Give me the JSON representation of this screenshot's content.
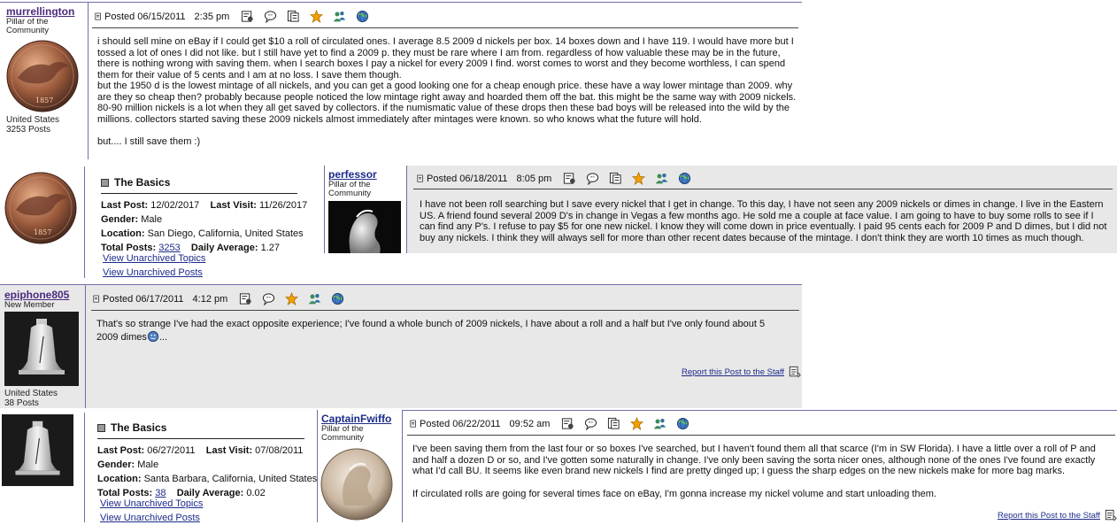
{
  "posts": [
    {
      "username": "murrellington",
      "rank": "Pillar of the Community",
      "location": "United States",
      "posts": "3253 Posts",
      "posted": "Posted 06/15/2011",
      "time": "2:35 pm",
      "body": [
        "i should sell mine on eBay if I could get $10 a roll of circulated ones. I average 8.5 2009 d nickels per box. 14 boxes down and I have 119. I would have more but I tossed a lot of ones I did not like. but I still have yet to find a 2009 p. they must be rare where I am from. regardless of how valuable these may be in the future, there is nothing wrong with saving them. when I search boxes I pay a nickel for every 2009 I find. worst comes to worst and they become worthless, I can spend them for their value of 5 cents and I am at no loss. I save them though.",
        "but the 1950 d is the lowest mintage of all nickels, and you can get a good looking one for a cheap enough price. these have a way lower mintage than 2009. why are they so cheap then? probably because people noticed the low mintage right away and hoarded them off the bat. this might be the same way with 2009 nickels. 80-90 million nickels is a lot when they all get saved by collectors. if the numismatic value of these drops then these bad boys will be released into the wild by the millions. collectors started saving these 2009 nickels almost immediately after mintages were known. so who knows what the future will hold.",
        "but.... I still save them :)"
      ]
    },
    {
      "username": "perfessor",
      "rank": "Pillar of the Community",
      "posted": "Posted 06/18/2011",
      "time": "8:05 pm",
      "body": "I have not been roll searching but I save every nickel that I get in change. To this day, I have not seen any 2009 nickels or dimes in change. I live in the Eastern US. A friend found several 2009 D's in change in Vegas a few months ago. He sold me a couple at face value. I am going to have to buy some rolls to see if I can find any P's. I refuse to pay $5 for one new nickel. I know they will come down in price eventually. I paid 95 cents each for 2009 P and D dimes, but I did not buy any nickels. I think they will always sell for more than other recent dates because of the mintage. I don't think they are worth 10 times as much though."
    },
    {
      "username": "epiphone805",
      "rank": "New Member",
      "location": "United States",
      "posts": "38 Posts",
      "posted": "Posted 06/17/2011",
      "time": "4:12 pm",
      "body": "That's so strange I've had the exact opposite experience; I've found a whole bunch of 2009 nickels, I have about a roll and a half but I've only found about 5 2009 dimes",
      "body_tail": "...",
      "report": "Report this Post to the Staff"
    },
    {
      "username": "CaptainFwiffo",
      "rank": "Pillar of the Community",
      "posted": "Posted 06/22/2011",
      "time": "09:52 am",
      "body": [
        "I've been saving them from the last four or so boxes I've searched, but I haven't found them all that scarce (I'm in SW Florida). I have a little over a roll of P and and half a dozen D or so, and I've gotten some naturally in change. I've only been saving the sorta nicer ones, although none of the ones I've found are exactly what I'd call BU. It seems like even brand new nickels I find are pretty dinged up; I guess the sharp edges on the new nickels make for more bag marks.",
        "If circulated rolls are going for several times face on eBay, I'm gonna increase my nickel volume and start unloading them."
      ],
      "report": "Report this Post to the Staff"
    }
  ],
  "basics": [
    {
      "title": "The Basics",
      "last_post_label": "Last Post:",
      "last_post": "12/02/2017",
      "last_visit_label": "Last Visit:",
      "last_visit": "11/26/2017",
      "gender_label": "Gender:",
      "gender": "Male",
      "location_label": "Location:",
      "location": "San Diego, California, United States",
      "total_posts_label": "Total Posts:",
      "total_posts": "3253",
      "daily_avg_label": "Daily Average:",
      "daily_avg": "1.27",
      "link1": "View Unarchived Topics",
      "link2": "View Unarchived Posts"
    },
    {
      "title": "The Basics",
      "last_post_label": "Last Post:",
      "last_post": "06/27/2011",
      "last_visit_label": "Last Visit:",
      "last_visit": "07/08/2011",
      "gender_label": "Gender:",
      "gender": "Male",
      "location_label": "Location:",
      "location": "Santa Barbara, California, United States",
      "total_posts_label": "Total Posts:",
      "total_posts": "38",
      "daily_avg_label": "Daily Average:",
      "daily_avg": "0.02",
      "link1": "View Unarchived Topics",
      "link2": "View Unarchived Posts"
    }
  ],
  "colors": {
    "post_bg_alt": "#e8e8e8",
    "rule": "#6f6faa",
    "link": "#1c2b8a",
    "username": "#4b2b7f",
    "star": "#f2a000"
  }
}
